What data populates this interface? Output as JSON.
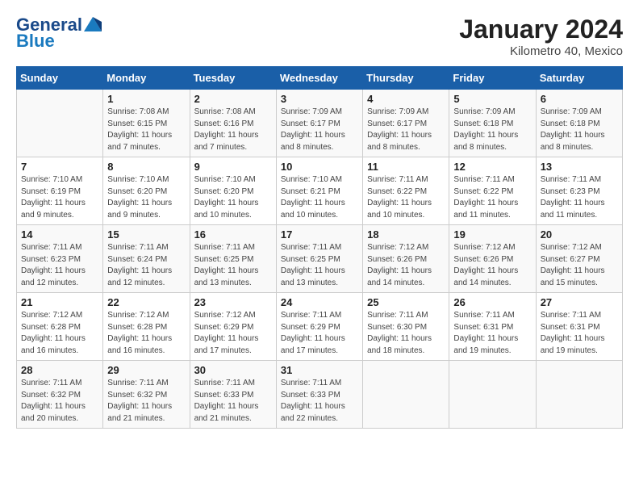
{
  "header": {
    "logo_line1": "General",
    "logo_line2": "Blue",
    "month": "January 2024",
    "location": "Kilometro 40, Mexico"
  },
  "weekdays": [
    "Sunday",
    "Monday",
    "Tuesday",
    "Wednesday",
    "Thursday",
    "Friday",
    "Saturday"
  ],
  "weeks": [
    [
      {
        "day": "",
        "sunrise": "",
        "sunset": "",
        "daylight": ""
      },
      {
        "day": "1",
        "sunrise": "Sunrise: 7:08 AM",
        "sunset": "Sunset: 6:15 PM",
        "daylight": "Daylight: 11 hours and 7 minutes."
      },
      {
        "day": "2",
        "sunrise": "Sunrise: 7:08 AM",
        "sunset": "Sunset: 6:16 PM",
        "daylight": "Daylight: 11 hours and 7 minutes."
      },
      {
        "day": "3",
        "sunrise": "Sunrise: 7:09 AM",
        "sunset": "Sunset: 6:17 PM",
        "daylight": "Daylight: 11 hours and 8 minutes."
      },
      {
        "day": "4",
        "sunrise": "Sunrise: 7:09 AM",
        "sunset": "Sunset: 6:17 PM",
        "daylight": "Daylight: 11 hours and 8 minutes."
      },
      {
        "day": "5",
        "sunrise": "Sunrise: 7:09 AM",
        "sunset": "Sunset: 6:18 PM",
        "daylight": "Daylight: 11 hours and 8 minutes."
      },
      {
        "day": "6",
        "sunrise": "Sunrise: 7:09 AM",
        "sunset": "Sunset: 6:18 PM",
        "daylight": "Daylight: 11 hours and 8 minutes."
      }
    ],
    [
      {
        "day": "7",
        "sunrise": "Sunrise: 7:10 AM",
        "sunset": "Sunset: 6:19 PM",
        "daylight": "Daylight: 11 hours and 9 minutes."
      },
      {
        "day": "8",
        "sunrise": "Sunrise: 7:10 AM",
        "sunset": "Sunset: 6:20 PM",
        "daylight": "Daylight: 11 hours and 9 minutes."
      },
      {
        "day": "9",
        "sunrise": "Sunrise: 7:10 AM",
        "sunset": "Sunset: 6:20 PM",
        "daylight": "Daylight: 11 hours and 10 minutes."
      },
      {
        "day": "10",
        "sunrise": "Sunrise: 7:10 AM",
        "sunset": "Sunset: 6:21 PM",
        "daylight": "Daylight: 11 hours and 10 minutes."
      },
      {
        "day": "11",
        "sunrise": "Sunrise: 7:11 AM",
        "sunset": "Sunset: 6:22 PM",
        "daylight": "Daylight: 11 hours and 10 minutes."
      },
      {
        "day": "12",
        "sunrise": "Sunrise: 7:11 AM",
        "sunset": "Sunset: 6:22 PM",
        "daylight": "Daylight: 11 hours and 11 minutes."
      },
      {
        "day": "13",
        "sunrise": "Sunrise: 7:11 AM",
        "sunset": "Sunset: 6:23 PM",
        "daylight": "Daylight: 11 hours and 11 minutes."
      }
    ],
    [
      {
        "day": "14",
        "sunrise": "Sunrise: 7:11 AM",
        "sunset": "Sunset: 6:23 PM",
        "daylight": "Daylight: 11 hours and 12 minutes."
      },
      {
        "day": "15",
        "sunrise": "Sunrise: 7:11 AM",
        "sunset": "Sunset: 6:24 PM",
        "daylight": "Daylight: 11 hours and 12 minutes."
      },
      {
        "day": "16",
        "sunrise": "Sunrise: 7:11 AM",
        "sunset": "Sunset: 6:25 PM",
        "daylight": "Daylight: 11 hours and 13 minutes."
      },
      {
        "day": "17",
        "sunrise": "Sunrise: 7:11 AM",
        "sunset": "Sunset: 6:25 PM",
        "daylight": "Daylight: 11 hours and 13 minutes."
      },
      {
        "day": "18",
        "sunrise": "Sunrise: 7:12 AM",
        "sunset": "Sunset: 6:26 PM",
        "daylight": "Daylight: 11 hours and 14 minutes."
      },
      {
        "day": "19",
        "sunrise": "Sunrise: 7:12 AM",
        "sunset": "Sunset: 6:26 PM",
        "daylight": "Daylight: 11 hours and 14 minutes."
      },
      {
        "day": "20",
        "sunrise": "Sunrise: 7:12 AM",
        "sunset": "Sunset: 6:27 PM",
        "daylight": "Daylight: 11 hours and 15 minutes."
      }
    ],
    [
      {
        "day": "21",
        "sunrise": "Sunrise: 7:12 AM",
        "sunset": "Sunset: 6:28 PM",
        "daylight": "Daylight: 11 hours and 16 minutes."
      },
      {
        "day": "22",
        "sunrise": "Sunrise: 7:12 AM",
        "sunset": "Sunset: 6:28 PM",
        "daylight": "Daylight: 11 hours and 16 minutes."
      },
      {
        "day": "23",
        "sunrise": "Sunrise: 7:12 AM",
        "sunset": "Sunset: 6:29 PM",
        "daylight": "Daylight: 11 hours and 17 minutes."
      },
      {
        "day": "24",
        "sunrise": "Sunrise: 7:11 AM",
        "sunset": "Sunset: 6:29 PM",
        "daylight": "Daylight: 11 hours and 17 minutes."
      },
      {
        "day": "25",
        "sunrise": "Sunrise: 7:11 AM",
        "sunset": "Sunset: 6:30 PM",
        "daylight": "Daylight: 11 hours and 18 minutes."
      },
      {
        "day": "26",
        "sunrise": "Sunrise: 7:11 AM",
        "sunset": "Sunset: 6:31 PM",
        "daylight": "Daylight: 11 hours and 19 minutes."
      },
      {
        "day": "27",
        "sunrise": "Sunrise: 7:11 AM",
        "sunset": "Sunset: 6:31 PM",
        "daylight": "Daylight: 11 hours and 19 minutes."
      }
    ],
    [
      {
        "day": "28",
        "sunrise": "Sunrise: 7:11 AM",
        "sunset": "Sunset: 6:32 PM",
        "daylight": "Daylight: 11 hours and 20 minutes."
      },
      {
        "day": "29",
        "sunrise": "Sunrise: 7:11 AM",
        "sunset": "Sunset: 6:32 PM",
        "daylight": "Daylight: 11 hours and 21 minutes."
      },
      {
        "day": "30",
        "sunrise": "Sunrise: 7:11 AM",
        "sunset": "Sunset: 6:33 PM",
        "daylight": "Daylight: 11 hours and 21 minutes."
      },
      {
        "day": "31",
        "sunrise": "Sunrise: 7:11 AM",
        "sunset": "Sunset: 6:33 PM",
        "daylight": "Daylight: 11 hours and 22 minutes."
      },
      {
        "day": "",
        "sunrise": "",
        "sunset": "",
        "daylight": ""
      },
      {
        "day": "",
        "sunrise": "",
        "sunset": "",
        "daylight": ""
      },
      {
        "day": "",
        "sunrise": "",
        "sunset": "",
        "daylight": ""
      }
    ]
  ]
}
